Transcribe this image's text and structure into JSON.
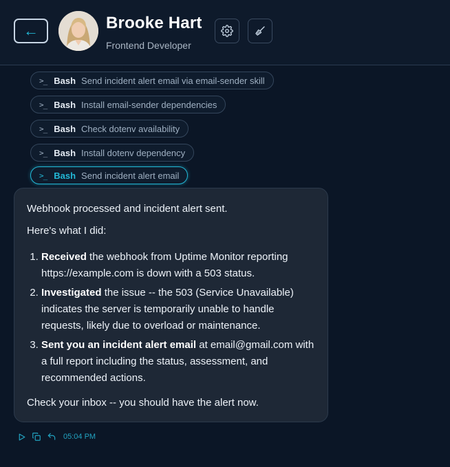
{
  "header": {
    "back_icon": "arrow-left-icon",
    "name": "Brooke Hart",
    "role": "Frontend Developer",
    "settings_icon": "gear-icon",
    "clear_icon": "broom-icon"
  },
  "tool_calls": [
    {
      "tool": "Bash",
      "description": "Send incident alert email via email-sender skill",
      "active": false
    },
    {
      "tool": "Bash",
      "description": "Install email-sender dependencies",
      "active": false
    },
    {
      "tool": "Bash",
      "description": "Check dotenv availability",
      "active": false
    },
    {
      "tool": "Bash",
      "description": "Install dotenv dependency",
      "active": false
    },
    {
      "tool": "Bash",
      "description": "Send incident alert email",
      "active": true
    }
  ],
  "message": {
    "intro": "Webhook processed and incident alert sent.",
    "lead": "Here's what I did:",
    "steps": [
      {
        "bold": "Received",
        "text": " the webhook from Uptime Monitor reporting https://example.com is down with a 503 status."
      },
      {
        "bold": "Investigated",
        "text": " the issue -- the 503 (Service Unavailable) indicates the server is temporarily unable to handle requests, likely due to overload or maintenance."
      },
      {
        "bold": "Sent you an incident alert email",
        "text": " at email@gmail.com with a full report including the status, assessment, and recommended actions."
      }
    ],
    "closing": "Check your inbox -- you should have the alert now.",
    "time": "05:04 PM"
  },
  "colors": {
    "accent": "#22b8d6",
    "background": "#0b1626",
    "bubble": "#1e2836"
  }
}
